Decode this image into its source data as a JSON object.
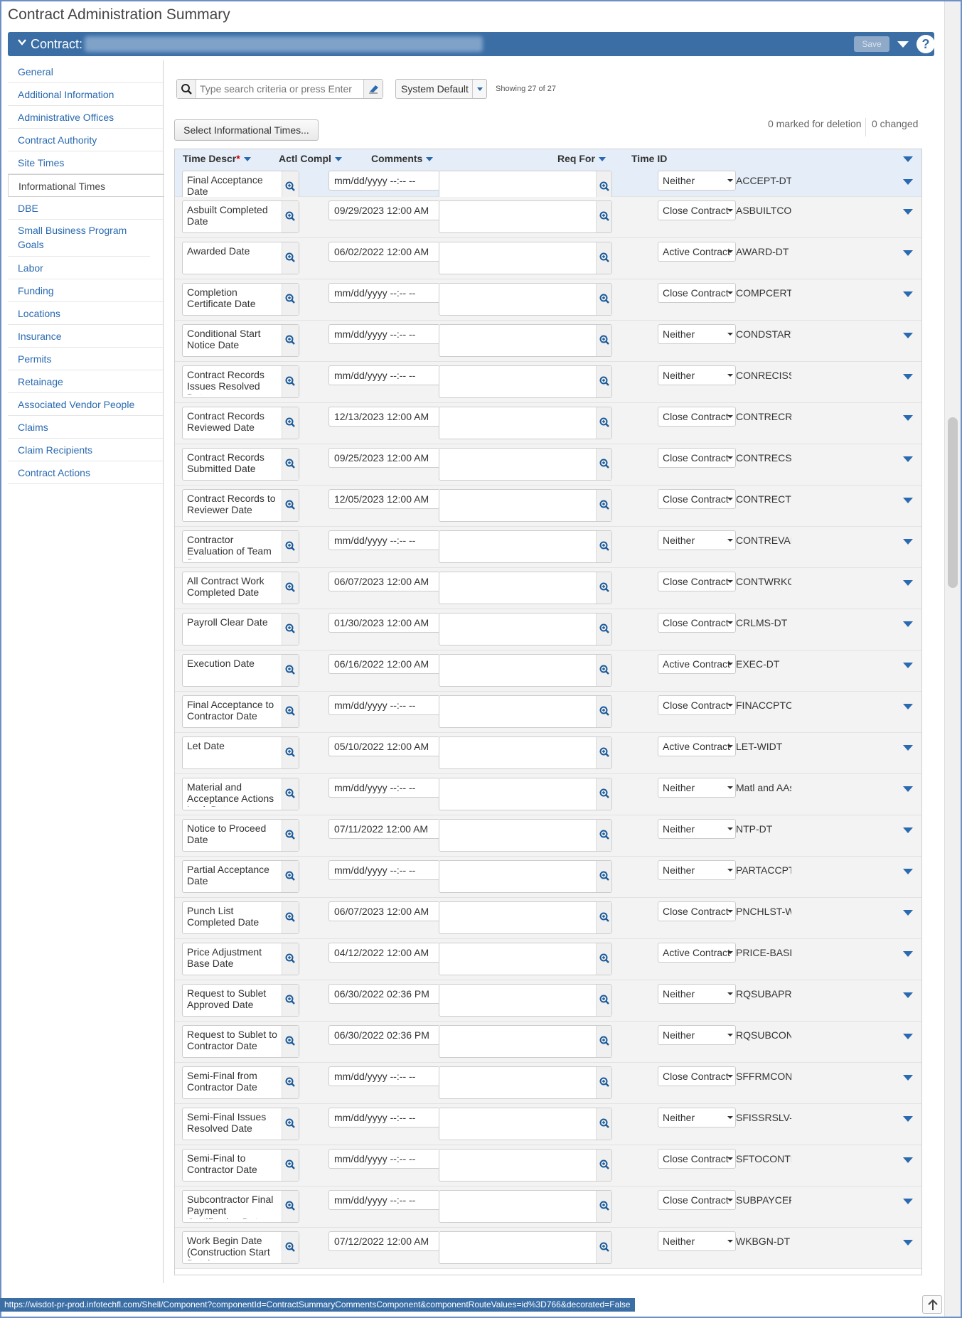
{
  "page": {
    "title": "Contract Administration Summary",
    "contract_label": "Contract:",
    "save_label": "Save",
    "help_label": "?"
  },
  "sidebar": {
    "items": [
      {
        "label": "General",
        "active": false
      },
      {
        "label": "Additional Information",
        "active": false
      },
      {
        "label": "Administrative Offices",
        "active": false
      },
      {
        "label": "Contract Authority",
        "active": false
      },
      {
        "label": "Site Times",
        "active": false
      },
      {
        "label": "Informational Times",
        "active": true
      },
      {
        "label": "DBE",
        "active": false
      },
      {
        "label": "Small Business Program Goals",
        "active": false
      },
      {
        "label": "Labor",
        "active": false
      },
      {
        "label": "Funding",
        "active": false
      },
      {
        "label": "Locations",
        "active": false
      },
      {
        "label": "Insurance",
        "active": false
      },
      {
        "label": "Permits",
        "active": false
      },
      {
        "label": "Retainage",
        "active": false
      },
      {
        "label": "Associated Vendor People",
        "active": false
      },
      {
        "label": "Claims",
        "active": false
      },
      {
        "label": "Claim Recipients",
        "active": false
      },
      {
        "label": "Contract Actions",
        "active": false
      }
    ]
  },
  "toolbar": {
    "search_placeholder": "Type search criteria or press Enter",
    "view_selected": "System Default",
    "showing": "Showing 27 of 27",
    "select_times_label": "Select Informational Times...",
    "marked_for_deletion": "0 marked for deletion",
    "changed": "0 changed"
  },
  "grid": {
    "columns": {
      "time_descr": "Time Descr",
      "required_marker": "*",
      "actl_compl": "Actl Compl",
      "comments": "Comments",
      "req_for": "Req For",
      "time_id": "Time ID"
    },
    "rows": [
      {
        "descr": "Final Acceptance Date",
        "date": "mm/dd/yyyy --:-- --",
        "req_for": "Neither",
        "time_id": "ACCEPT-DT"
      },
      {
        "descr": "Asbuilt Completed Date",
        "date": "09/29/2023 12:00  AM",
        "req_for": "Close Contract",
        "time_id": "ASBUILTCOM"
      },
      {
        "descr": "Awarded Date",
        "date": "06/02/2022 12:00  AM",
        "req_for": "Active Contract",
        "time_id": "AWARD-DT"
      },
      {
        "descr": "Completion Certificate Date",
        "date": "mm/dd/yyyy --:-- --",
        "req_for": "Close Contract",
        "time_id": "COMPCERT-V"
      },
      {
        "descr": "Conditional Start Notice Date",
        "date": "mm/dd/yyyy --:-- --",
        "req_for": "Neither",
        "time_id": "CONDSTARTI"
      },
      {
        "descr": "Contract Records Issues Resolved Date",
        "date": "mm/dd/yyyy --:-- --",
        "req_for": "Neither",
        "time_id": "CONRECISSF"
      },
      {
        "descr": "Contract Records Reviewed Date",
        "date": "12/13/2023 12:00  AM",
        "req_for": "Close Contract",
        "time_id": "CONTRECRE"
      },
      {
        "descr": "Contract Records Submitted Date",
        "date": "09/25/2023 12:00  AM",
        "req_for": "Close Contract",
        "time_id": "CONTRECSU"
      },
      {
        "descr": "Contract Records to Reviewer Date",
        "date": "12/05/2023 12:00  AM",
        "req_for": "Close Contract",
        "time_id": "CONTRECTO"
      },
      {
        "descr": "Contractor Evaluation of Team Date",
        "date": "mm/dd/yyyy --:-- --",
        "req_for": "Neither",
        "time_id": "CONTREVALT"
      },
      {
        "descr": "All Contract Work Completed Date",
        "date": "06/07/2023 12:00  AM",
        "req_for": "Close Contract",
        "time_id": "CONTWRKCN"
      },
      {
        "descr": "Payroll Clear Date",
        "date": "01/30/2023 12:00  AM",
        "req_for": "Close Contract",
        "time_id": "CRLMS-DT"
      },
      {
        "descr": "Execution Date",
        "date": "06/16/2022 12:00  AM",
        "req_for": "Active Contract",
        "time_id": "EXEC-DT"
      },
      {
        "descr": "Final Acceptance to Contractor Date",
        "date": "mm/dd/yyyy --:-- --",
        "req_for": "Close Contract",
        "time_id": "FINACCPTCC"
      },
      {
        "descr": "Let Date",
        "date": "05/10/2022 12:00  AM",
        "req_for": "Active Contract",
        "time_id": "LET-WIDT"
      },
      {
        "descr": "Material and Acceptance Actions Lock Date",
        "date": "mm/dd/yyyy --:-- --",
        "req_for": "Neither",
        "time_id": "Matl and AAs I",
        "scroll": true
      },
      {
        "descr": "Notice to Proceed Date",
        "date": "07/11/2022 12:00  AM",
        "req_for": "Neither",
        "time_id": "NTP-DT"
      },
      {
        "descr": "Partial Acceptance Date",
        "date": "mm/dd/yyyy --:-- --",
        "req_for": "Neither",
        "time_id": "PARTACCPT-\\"
      },
      {
        "descr": "Punch List Completed Date",
        "date": "06/07/2023 12:00  AM",
        "req_for": "Close Contract",
        "time_id": "PNCHLST-WII"
      },
      {
        "descr": "Price Adjustment Base Date",
        "date": "04/12/2022 12:00  AM",
        "req_for": "Active Contract",
        "time_id": "PRICE-BASE-"
      },
      {
        "descr": "Request to Sublet Approved Date",
        "date": "06/30/2022 02:36  PM",
        "req_for": "Neither",
        "time_id": "RQSUBAPR-V"
      },
      {
        "descr": "Request to Sublet to Contractor Date",
        "date": "06/30/2022 02:36  PM",
        "req_for": "Neither",
        "time_id": "RQSUBCONT"
      },
      {
        "descr": "Semi-Final from Contractor Date",
        "date": "mm/dd/yyyy --:-- --",
        "req_for": "Close Contract",
        "time_id": "SFFRMCONT"
      },
      {
        "descr": "Semi-Final Issues Resolved Date",
        "date": "mm/dd/yyyy --:-- --",
        "req_for": "Neither",
        "time_id": "SFISSRSLV-W"
      },
      {
        "descr": "Semi-Final to Contractor Date",
        "date": "mm/dd/yyyy --:-- --",
        "req_for": "Close Contract",
        "time_id": "SFTOCONTR"
      },
      {
        "descr": "Subcontractor Final Payment Certification Date",
        "date": "mm/dd/yyyy --:-- --",
        "req_for": "Close Contract",
        "time_id": "SUBPAYCERT",
        "scroll": true
      },
      {
        "descr": "Work Begin Date (Construction Start Date)",
        "date": "07/12/2022 12:00  AM",
        "req_for": "Neither",
        "time_id": "WKBGN-DT",
        "scroll": true
      }
    ]
  },
  "status_bar": {
    "url": "https://wisdot-pr-prod.infotechfl.com/Shell/Component?componentId=ContractSummaryCommentsComponent&componentRouteValues=id%3D766&decorated=False"
  },
  "icons": {
    "collapse": "chevron-down-icon",
    "search": "search-icon",
    "clear": "eraser-icon",
    "zoom": "zoom-in-icon",
    "row_menu": "caret-down-icon",
    "help": "help-icon",
    "scroll_top": "arrow-up-icon"
  },
  "colors": {
    "accent": "#3a6ea5",
    "link": "#2a6ab0",
    "header_row": "#e5eef8",
    "required": "#cc0000"
  }
}
